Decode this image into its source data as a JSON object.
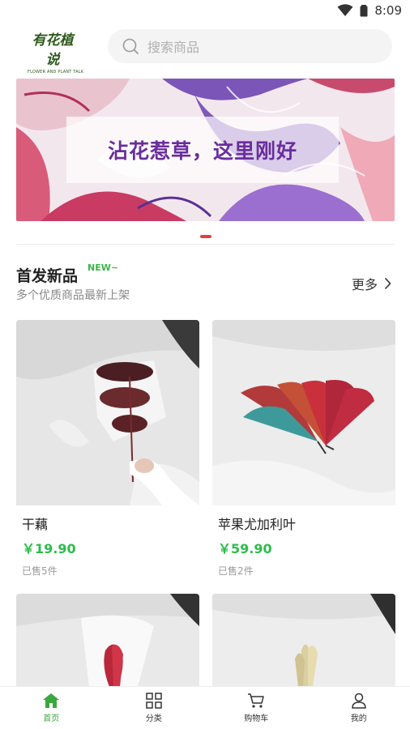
{
  "status_bar": {
    "time": "8:09",
    "icons": [
      "wifi-icon",
      "battery-icon"
    ]
  },
  "header": {
    "logo": {
      "cn": "有花植说",
      "en": "FLOWER AND PLANT TALK"
    },
    "search": {
      "placeholder": "搜索商品",
      "icon": "search-icon"
    }
  },
  "banner": {
    "caption": "沾花惹草，这里刚好",
    "active_index": 0
  },
  "section": {
    "title": "首发新品",
    "badge": "NEW~",
    "subtitle": "多个优质商品最新上架",
    "more": "更多",
    "more_icon": "chevron-right-icon"
  },
  "products": [
    {
      "name": "干藕",
      "price": "￥19.90",
      "sold": "已售5件"
    },
    {
      "name": "苹果尤加利叶",
      "price": "￥59.90",
      "sold": "已售2件"
    },
    {
      "name": "",
      "price": "",
      "sold": ""
    },
    {
      "name": "",
      "price": "",
      "sold": ""
    }
  ],
  "tabbar": {
    "active": "home",
    "items": [
      {
        "key": "home",
        "label": "首页",
        "icon": "home-icon"
      },
      {
        "key": "category",
        "label": "分类",
        "icon": "grid-icon"
      },
      {
        "key": "cart",
        "label": "购物车",
        "icon": "cart-icon"
      },
      {
        "key": "mine",
        "label": "我的",
        "icon": "user-icon"
      }
    ]
  },
  "colors": {
    "accent_green": "#2bbd4b",
    "tab_active": "#3aa83f",
    "indicator": "#e0413b",
    "banner_text": "#6a2d9c"
  }
}
